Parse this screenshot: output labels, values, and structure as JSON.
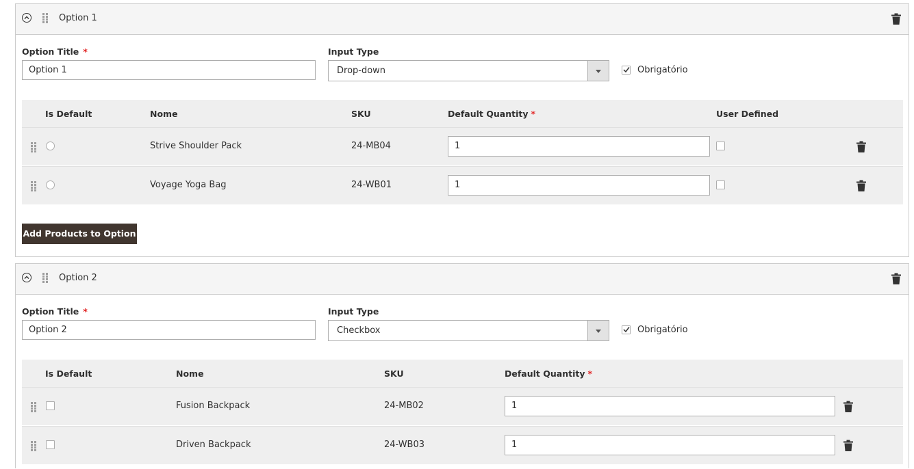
{
  "options": [
    {
      "header_title": "Option 1",
      "title_label": "Option Title",
      "title_value": "Option 1",
      "input_type_label": "Input Type",
      "input_type_value": "Drop-down",
      "required_label": "Obrigatório",
      "required_checked": true,
      "columns": [
        "Is Default",
        "Nome",
        "SKU",
        "Default Quantity",
        "User Defined"
      ],
      "rows": [
        {
          "name": "Strive Shoulder Pack",
          "sku": "24-MB04",
          "qty": "1"
        },
        {
          "name": "Voyage Yoga Bag",
          "sku": "24-WB01",
          "qty": "1"
        }
      ],
      "add_button": "Add Products to Option"
    },
    {
      "header_title": "Option 2",
      "title_label": "Option Title",
      "title_value": "Option 2",
      "input_type_label": "Input Type",
      "input_type_value": "Checkbox",
      "required_label": "Obrigatório",
      "required_checked": true,
      "columns": [
        "Is Default",
        "Nome",
        "SKU",
        "Default Quantity"
      ],
      "rows": [
        {
          "name": "Fusion Backpack",
          "sku": "24-MB02",
          "qty": "1"
        },
        {
          "name": "Driven Backpack",
          "sku": "24-WB03",
          "qty": "1"
        }
      ]
    }
  ],
  "required_mark": "*",
  "colors": {
    "accent_button": "#41362f",
    "required": "#e22626"
  }
}
